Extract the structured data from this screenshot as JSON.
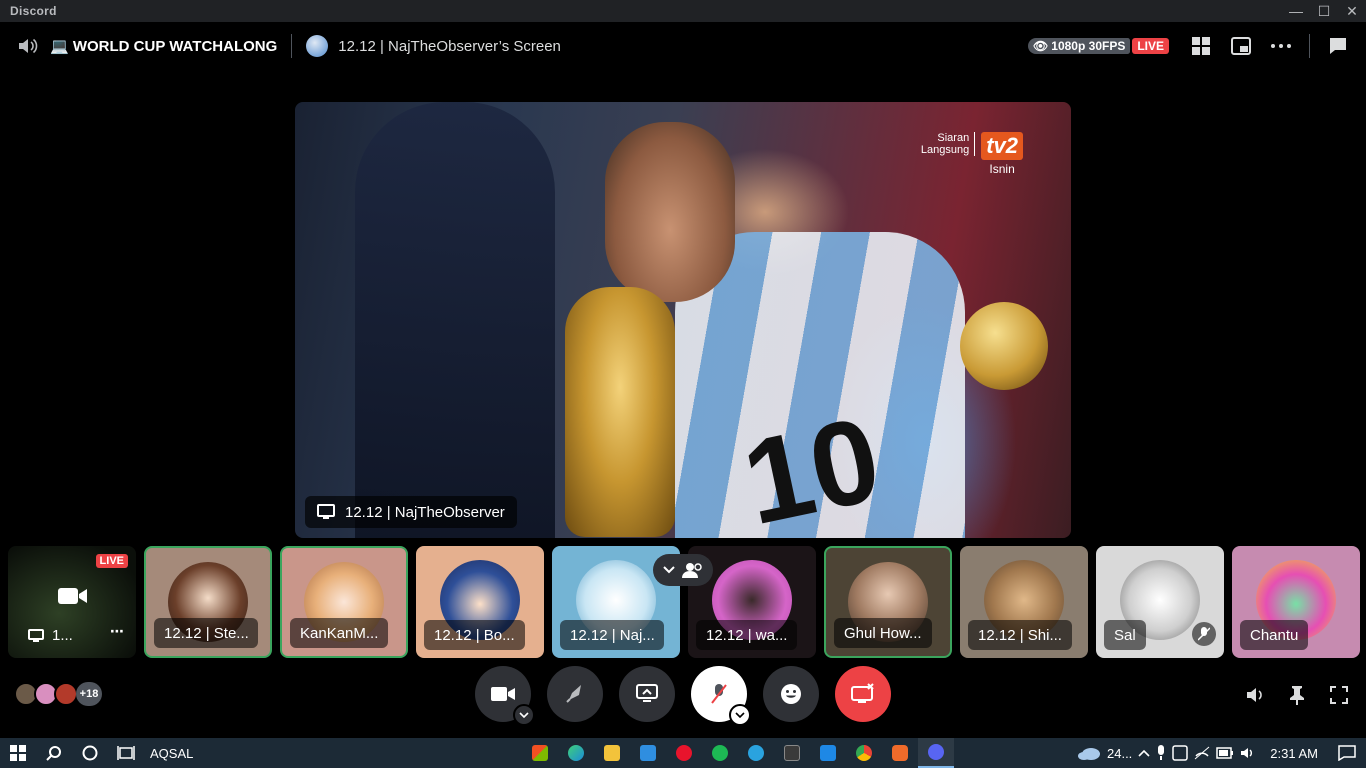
{
  "window": {
    "app_name": "Discord",
    "minimize": "—",
    "maximize": "☐",
    "close": "✕"
  },
  "header": {
    "channel_name": "💻 WORLD CUP WATCHALONG",
    "stream_title": "12.12 | NajTheObserver’s Screen",
    "quality": "1080p 30FPS",
    "live": "LIVE"
  },
  "stream": {
    "broadcast_siaran": "Siaran",
    "broadcast_langsung": "Langsung",
    "broadcast_logo": "tv2",
    "broadcast_day": "Isnin",
    "jersey_number": "10",
    "streamer_label": "12.12 | NajTheObserver"
  },
  "participants": [
    {
      "name": "1...",
      "live": "LIVE",
      "kind": "stream"
    },
    {
      "name": "12.12 | Ste...",
      "speaking": true
    },
    {
      "name": "KanKanM...",
      "speaking": true
    },
    {
      "name": "12.12 | Bo..."
    },
    {
      "name": "12.12 | Naj..."
    },
    {
      "name": "12.12 | wa..."
    },
    {
      "name": "Ghul How...",
      "speaking": true
    },
    {
      "name": "12.12 | Shi..."
    },
    {
      "name": "Sal",
      "muted": true
    },
    {
      "name": "Chantu"
    }
  ],
  "voice_members": {
    "more": "+18"
  },
  "taskbar": {
    "search_label": "AQSAL",
    "weather": "24...",
    "time": "2:31 AM"
  },
  "colors": {
    "live_red": "#ed4245",
    "speaking_green": "#3ba55d",
    "disconnect_red": "#ed4245"
  }
}
